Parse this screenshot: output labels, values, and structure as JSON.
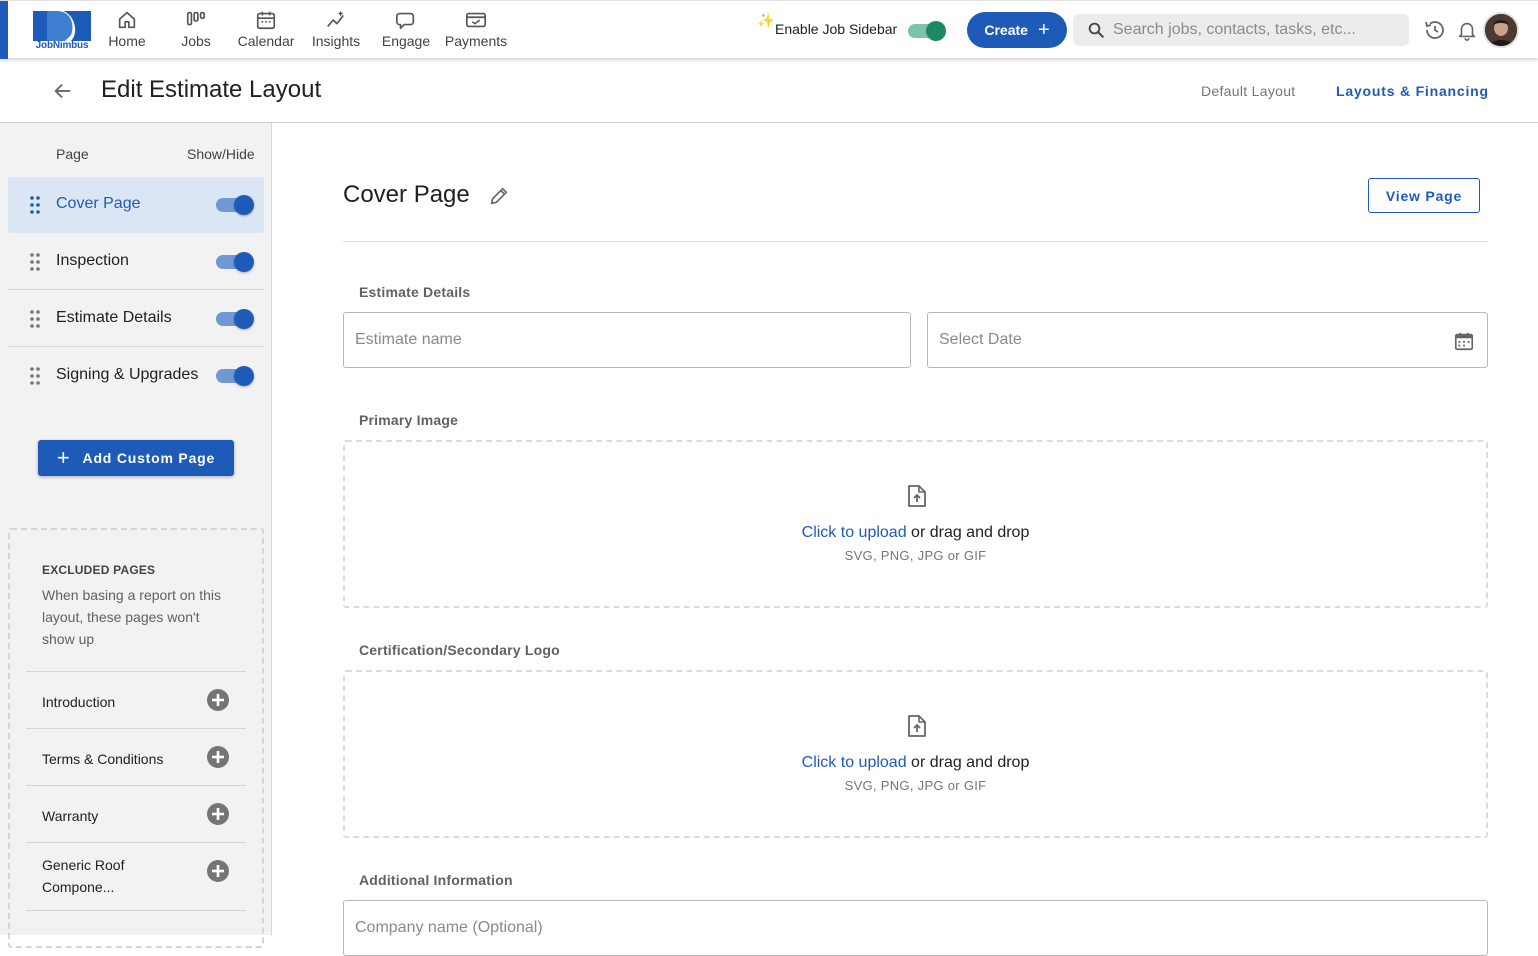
{
  "nav": {
    "logo_text": "JobNimbus",
    "items": [
      {
        "label": "Home",
        "icon": "home-icon"
      },
      {
        "label": "Jobs",
        "icon": "jobs-icon"
      },
      {
        "label": "Calendar",
        "icon": "calendar-icon"
      },
      {
        "label": "Insights",
        "icon": "insights-icon"
      },
      {
        "label": "Engage",
        "icon": "engage-icon"
      },
      {
        "label": "Payments",
        "icon": "payments-icon"
      }
    ],
    "sparkle": "✨",
    "enable_sidebar_label": "Enable Job Sidebar",
    "enable_sidebar_on": true,
    "create_label": "Create",
    "create_plus": "+",
    "search_placeholder": "Search jobs, contacts, tasks, etc..."
  },
  "header": {
    "title": "Edit Estimate Layout",
    "links": {
      "default_layout": "Default Layout",
      "layouts_financing": "Layouts & Financing"
    },
    "active_link": "Layouts & Financing"
  },
  "sidebar": {
    "col_page": "Page",
    "col_show_hide": "Show/Hide",
    "pages": [
      {
        "name": "Cover Page",
        "shown": true,
        "selected": true
      },
      {
        "name": "Inspection",
        "shown": true,
        "selected": false
      },
      {
        "name": "Estimate Details",
        "shown": true,
        "selected": false
      },
      {
        "name": "Signing & Upgrades",
        "shown": true,
        "selected": false
      }
    ],
    "add_custom_page_plus": "+",
    "add_custom_page_label": "Add Custom Page",
    "excluded_title": "EXCLUDED PAGES",
    "excluded_desc": "When basing a report on this layout, these pages won't show up",
    "excluded": [
      "Introduction",
      "Terms & Conditions",
      "Warranty",
      "Generic Roof Compone..."
    ]
  },
  "main": {
    "page_title": "Cover Page",
    "view_page_label": "View Page",
    "estimate_details_label": "Estimate Details",
    "estimate_name_placeholder": "Estimate name",
    "select_date_placeholder": "Select Date",
    "primary_image_label": "Primary Image",
    "secondary_logo_label": "Certification/Secondary Logo",
    "upload_link": "Click to upload",
    "upload_rest": " or drag and drop",
    "upload_formats": "SVG, PNG, JPG or GIF",
    "additional_info_label": "Additional Information",
    "company_name_placeholder": "Company name (Optional)"
  },
  "colors": {
    "brand_blue": "#1e5bb8",
    "toggle_green": "#1b8a63",
    "selected_row_bg": "#dbe6f4"
  }
}
